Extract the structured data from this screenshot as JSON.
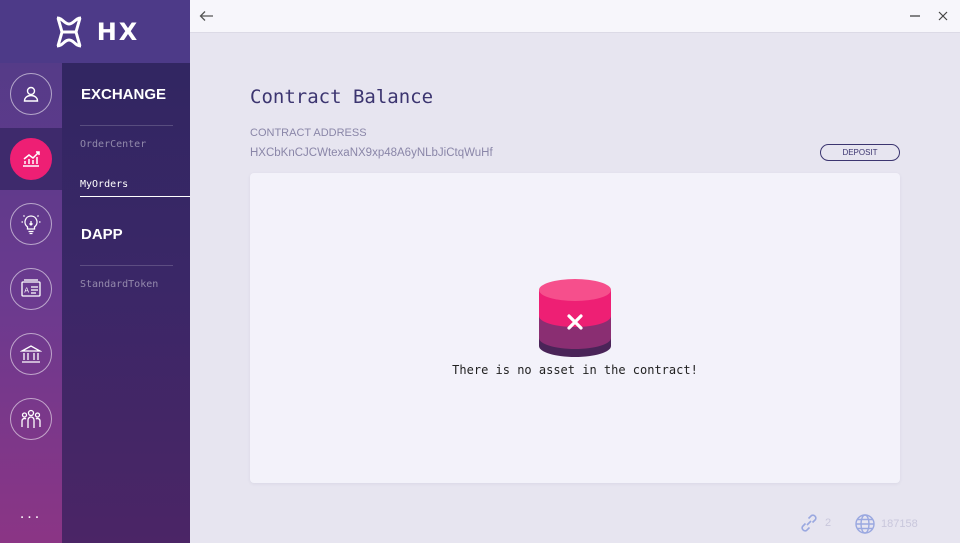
{
  "app": {
    "logo_text": "HX"
  },
  "rail": {
    "items": [
      {
        "icon": "user-icon",
        "active": false
      },
      {
        "icon": "exchange-chart-icon",
        "active": true
      },
      {
        "icon": "lightbulb-icon",
        "active": false
      },
      {
        "icon": "id-card-icon",
        "active": false
      },
      {
        "icon": "bank-icon",
        "active": false
      },
      {
        "icon": "community-icon",
        "active": false
      }
    ],
    "more_label": "..."
  },
  "submenu": {
    "exchange_heading": "EXCHANGE",
    "order_center": "OrderCenter",
    "my_orders": "MyOrders",
    "dapp_heading": "DAPP",
    "standard_token": "StandardToken"
  },
  "main": {
    "title": "Contract Balance",
    "contract_address_label": "CONTRACT ADDRESS",
    "contract_address": "HXCbKnCJCWtexaNX9xp48A6yNLbJiCtqWuHf",
    "deposit_label": "DEPOSIT",
    "empty_message": "There is no asset in the contract!"
  },
  "status_bar": {
    "connections": "2",
    "block_height": "187158"
  },
  "colors": {
    "accent": "#ee1f74",
    "rail_top": "#4f3b86",
    "submenu_bg": "#2f2660",
    "title_text": "#3c3570"
  }
}
